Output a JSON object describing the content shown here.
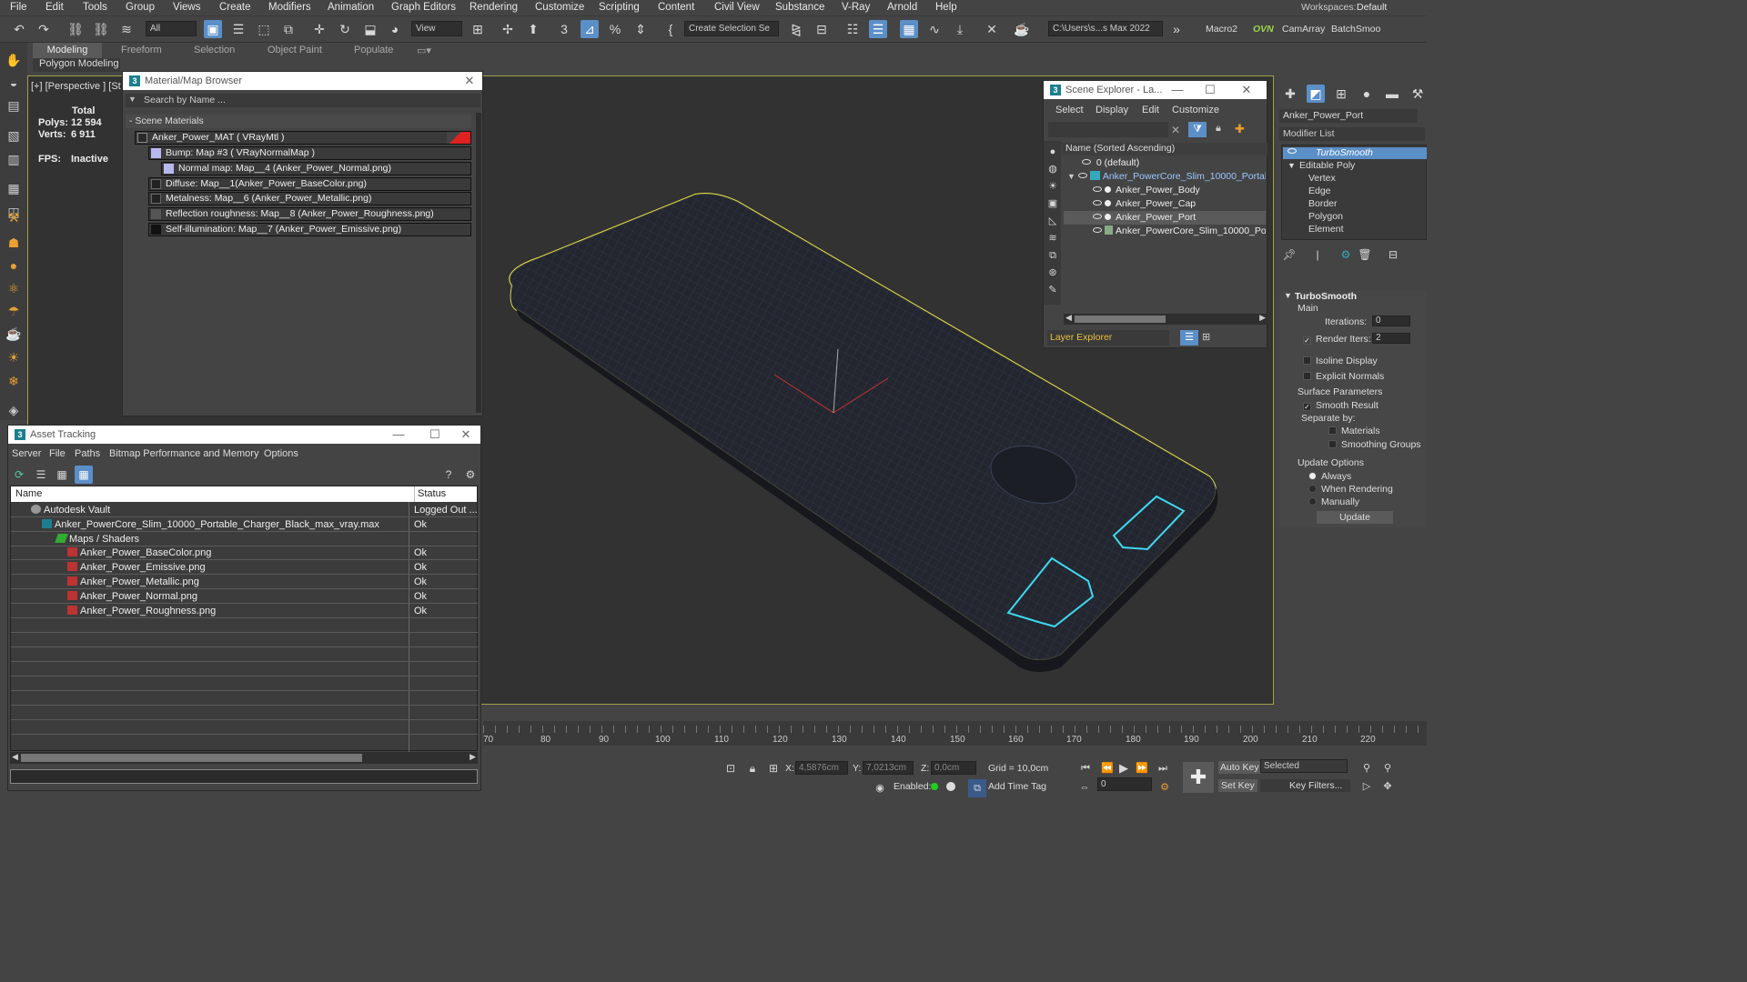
{
  "menubar": {
    "items": [
      "File",
      "Edit",
      "Tools",
      "Group",
      "Views",
      "Create",
      "Modifiers",
      "Animation",
      "Graph Editors",
      "Rendering",
      "Customize",
      "Scripting",
      "Content",
      "Civil View",
      "Substance",
      "V-Ray",
      "Arnold",
      "Help"
    ],
    "workspaces_label": "Workspaces:",
    "workspaces_value": "Default"
  },
  "toolbar": {
    "filter_value": "All",
    "view_value": "View",
    "selection_set": "Create Selection Se",
    "project_path": "C:\\Users\\s...s Max 2022",
    "macro": "Macro2",
    "ovn": "OVN",
    "camarray": "CamArray",
    "batchsmooth": "BatchSmoo"
  },
  "ribbon": {
    "tabs": [
      "Modeling",
      "Freeform",
      "Selection",
      "Object Paint",
      "Populate"
    ],
    "panel": "Polygon Modeling"
  },
  "viewport": {
    "label": "[+] [Perspective ] [St",
    "stats_total": "Total",
    "polys_label": "Polys:",
    "polys_value": "12 594",
    "verts_label": "Verts:",
    "verts_value": "6 911",
    "fps_label": "FPS:",
    "fps_value": "Inactive"
  },
  "material_browser": {
    "title": "Material/Map Browser",
    "search_placeholder": "Search by Name ...",
    "section": "- Scene Materials",
    "rows": [
      {
        "text": "Anker_Power_MAT  ( VRayMtl )",
        "swatch": "#2a2a2a"
      },
      {
        "text": "Bump: Map #3  ( VRayNormalMap )",
        "swatch": "#b8b8f0"
      },
      {
        "text": "Normal map: Map__4 (Anker_Power_Normal.png)",
        "swatch": "#b8b8f0"
      },
      {
        "text": "Diffuse: Map__1(Anker_Power_BaseColor.png)",
        "swatch": "#222"
      },
      {
        "text": "Metalness: Map__6 (Anker_Power_Metallic.png)",
        "swatch": "#222"
      },
      {
        "text": "Reflection roughness: Map__8 (Anker_Power_Roughness.png)",
        "swatch": "#555"
      },
      {
        "text": "Self-illumination: Map__7 (Anker_Power_Emissive.png)",
        "swatch": "#111"
      }
    ]
  },
  "asset_tracking": {
    "title": "Asset Tracking",
    "menu": [
      "Server",
      "File",
      "Paths",
      "Bitmap Performance and Memory",
      "Options"
    ],
    "col_name": "Name",
    "col_status": "Status",
    "rows": [
      {
        "name": "Autodesk Vault",
        "status": "Logged Out ..."
      },
      {
        "name": "Anker_PowerCore_Slim_10000_Portable_Charger_Black_max_vray.max",
        "status": "Ok"
      },
      {
        "name": "Maps / Shaders",
        "status": ""
      },
      {
        "name": "Anker_Power_BaseColor.png",
        "status": "Ok"
      },
      {
        "name": "Anker_Power_Emissive.png",
        "status": "Ok"
      },
      {
        "name": "Anker_Power_Metallic.png",
        "status": "Ok"
      },
      {
        "name": "Anker_Power_Normal.png",
        "status": "Ok"
      },
      {
        "name": "Anker_Power_Roughness.png",
        "status": "Ok"
      }
    ]
  },
  "scene_explorer": {
    "title": "Scene Explorer - La...",
    "menu": [
      "Select",
      "Display",
      "Edit",
      "Customize"
    ],
    "column": "Name (Sorted Ascending)",
    "rows": [
      {
        "name": "0 (default)"
      },
      {
        "name": "Anker_PowerCore_Slim_10000_Portable_C"
      },
      {
        "name": "Anker_Power_Body"
      },
      {
        "name": "Anker_Power_Cap"
      },
      {
        "name": "Anker_Power_Port"
      },
      {
        "name": "Anker_PowerCore_Slim_10000_Portab"
      }
    ],
    "layer_explorer": "Layer Explorer"
  },
  "command_panel": {
    "object_name": "Anker_Power_Port",
    "modifier_list": "Modifier List",
    "stack": [
      "TurboSmooth",
      "Editable Poly",
      "Vertex",
      "Edge",
      "Border",
      "Polygon",
      "Element"
    ],
    "rollout_title": "TurboSmooth",
    "main": "Main",
    "iterations_label": "Iterations:",
    "iterations_value": "0",
    "render_iters_label": "Render Iters:",
    "render_iters_value": "2",
    "isoline": "Isoline Display",
    "explicit_normals": "Explicit Normals",
    "surface_params": "Surface Parameters",
    "smooth_result": "Smooth Result",
    "separate_by": "Separate by:",
    "materials": "Materials",
    "smoothing_groups": "Smoothing Groups",
    "update_options": "Update Options",
    "always": "Always",
    "when_rendering": "When Rendering",
    "manually": "Manually",
    "update_button": "Update"
  },
  "timeline": {
    "ticks": [
      "70",
      "80",
      "90",
      "100",
      "110",
      "120",
      "130",
      "140",
      "150",
      "160",
      "170",
      "180",
      "190",
      "200",
      "210",
      "220"
    ]
  },
  "statusbar": {
    "x_label": "X:",
    "x_value": "4,5876cm",
    "y_label": "Y:",
    "y_value": "7,0213cm",
    "z_label": "Z:",
    "z_value": "0,0cm",
    "grid": "Grid = 10,0cm",
    "enabled": "Enabled:",
    "add_time_tag": "Add Time Tag",
    "auto_key": "Auto Key",
    "selected": "Selected",
    "set_key": "Set Key",
    "key_filters": "Key Filters...",
    "frame": "0"
  },
  "colors": {
    "selection_yellow": "#e8e24a",
    "highlight_cyan": "#3fd8f0",
    "accent_blue": "#5b8fc7"
  }
}
